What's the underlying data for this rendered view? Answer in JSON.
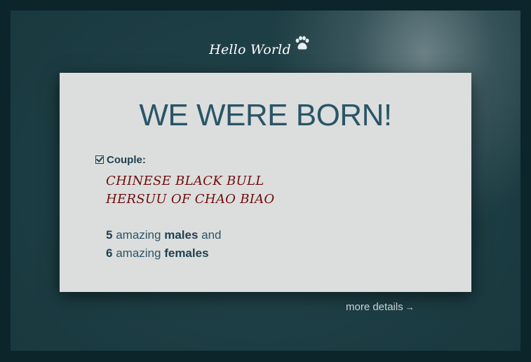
{
  "site": {
    "title": "Hello World",
    "logo_icon": "paw-icon"
  },
  "card": {
    "title": "WE WERE BORN!",
    "couple_label": "Couple:",
    "couple_icon": "checkbox-icon",
    "sire": "CHINESE BLACK BULL",
    "dam": "HERSUU OF CHAO BIAO",
    "males_count": "5",
    "males_text_1": "amazing",
    "males_label": "males",
    "males_text_2": "and",
    "females_count": "6",
    "females_text_1": "amazing",
    "females_label": "females"
  },
  "footer": {
    "more_details": "more details",
    "arrow_icon": "arrow-right-icon"
  },
  "colors": {
    "background": "#16353b",
    "card": "#dcdedd",
    "title": "#2a5566",
    "parents": "#6e0d0d"
  }
}
